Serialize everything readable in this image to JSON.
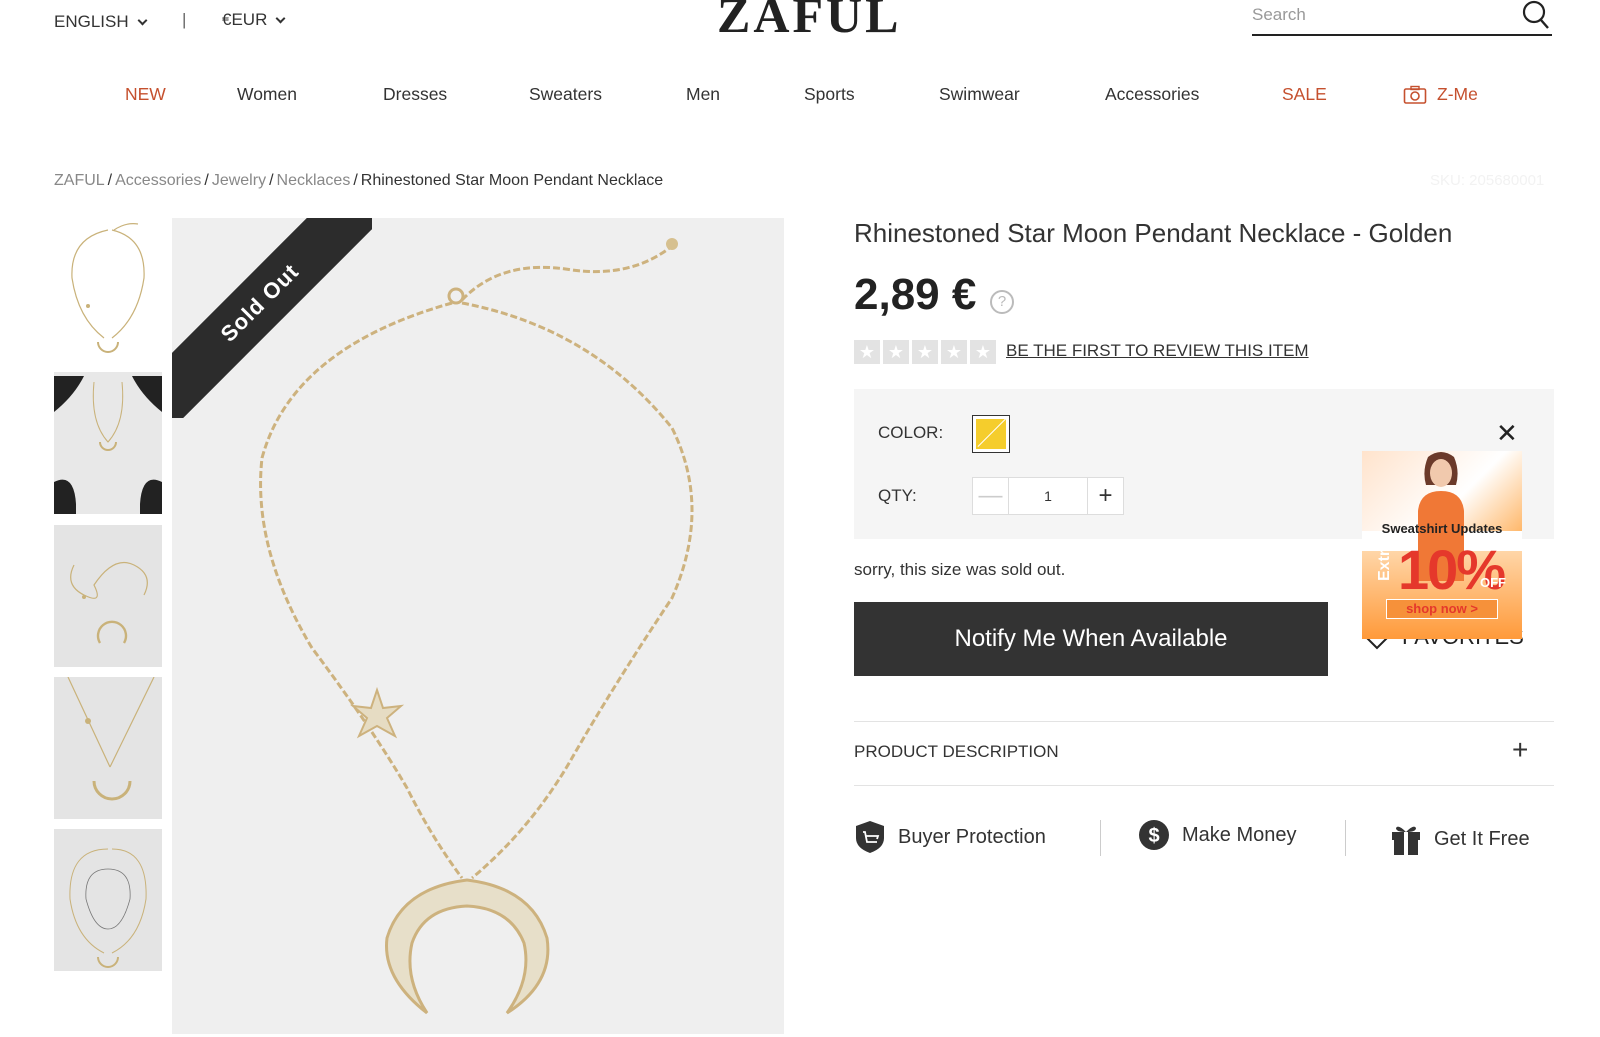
{
  "topbar": {
    "language": "ENGLISH",
    "separator": "|",
    "currency": "€EUR",
    "logo": "ZAFUL",
    "search_placeholder": "Search"
  },
  "nav": {
    "items": [
      "NEW",
      "Women",
      "Dresses",
      "Sweaters",
      "Men",
      "Sports",
      "Swimwear",
      "Accessories",
      "SALE",
      "Z-Me"
    ]
  },
  "breadcrumb": {
    "items": [
      "ZAFUL",
      "Accessories",
      "Jewelry",
      "Necklaces"
    ],
    "separator": "/",
    "current": "Rhinestoned Star Moon Pendant Necklace",
    "sku": "SKU: 205680001"
  },
  "gallery": {
    "ribbon": "Sold Out",
    "thumbnails": [
      "necklace-flat",
      "necklace-on-bust",
      "necklace-coiled",
      "necklace-closeup",
      "necklace-measurements"
    ]
  },
  "product": {
    "title": "Rhinestoned Star Moon Pendant Necklace - Golden",
    "price": "2,89 €",
    "help": "?",
    "rating_stars": 5,
    "rating_filled": 0,
    "review_link": "BE THE FIRST TO REVIEW THIS ITEM",
    "color_label": "COLOR:",
    "color_swatch": "#f5cd2c",
    "qty_label": "QTY:",
    "qty_value": "1",
    "sold_message": "sorry, this size was sold out.",
    "notify_button": "Notify Me When Available",
    "favorites": "FAVORITES",
    "description_label": "PRODUCT DESCRIPTION"
  },
  "promo": {
    "headline": "Sweatshirt Updates",
    "extra": "Extra",
    "percent": "10%",
    "off": "OFF",
    "button": "shop now >"
  },
  "services": {
    "buyer": "Buyer Protection",
    "money": "Make Money",
    "free": "Get It Free"
  },
  "colors": {
    "accent_red": "#c5502e",
    "dark": "#333333",
    "gold": "#c9b27a"
  }
}
